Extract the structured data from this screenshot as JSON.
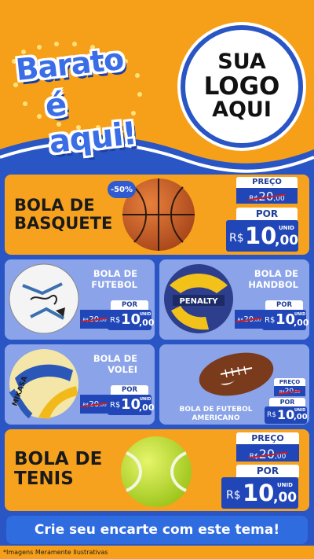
{
  "header": {
    "brand_line1": "Barato",
    "brand_line2": "é aqui!",
    "logo_line1": "SUA",
    "logo_line2": "LOGO",
    "logo_line3": "AQUI"
  },
  "featured_top": {
    "title_line1": "BOLA DE",
    "title_line2": "BASQUETE",
    "badge": "-50%",
    "price_label": "PREÇO",
    "old_price": "R$20,00",
    "old_cur": "R$",
    "old_int": "20",
    "old_dec": ",00",
    "por_label": "POR",
    "currency": "R$",
    "price_int": "10",
    "price_dec": ",00",
    "unit": "UNID"
  },
  "grid": [
    {
      "title_line1": "BOLA DE",
      "title_line2": "FUTEBOL",
      "por_label": "POR",
      "old_cur": "R$",
      "old_int": "20",
      "old_dec": ",00",
      "currency": "R$",
      "price_int": "10",
      "price_dec": ",00",
      "unit": "UNID"
    },
    {
      "title_line1": "BOLA DE",
      "title_line2": "HANDBOL",
      "por_label": "POR",
      "old_cur": "R$",
      "old_int": "20",
      "old_dec": ",00",
      "currency": "R$",
      "price_int": "10",
      "price_dec": ",00",
      "unit": "UNID"
    },
    {
      "title_line1": "BOLA DE",
      "title_line2": "VOLEI",
      "por_label": "POR",
      "old_cur": "R$",
      "old_int": "20",
      "old_dec": ",00",
      "currency": "R$",
      "price_int": "10",
      "price_dec": ",00",
      "unit": "UNID"
    },
    {
      "title_line1": "BOLA DE FUTEBOL",
      "title_line2": "AMERICANO",
      "price_label": "PREÇO",
      "por_label": "POR",
      "old_cur": "R$",
      "old_int": "20",
      "old_dec": ",00",
      "currency": "R$",
      "price_int": "10",
      "price_dec": ",00",
      "unit": "UNID"
    }
  ],
  "featured_bottom": {
    "title_line1": "BOLA DE",
    "title_line2": "TENIS",
    "price_label": "PREÇO",
    "old_cur": "R$",
    "old_int": "20",
    "old_dec": ",00",
    "por_label": "POR",
    "currency": "R$",
    "price_int": "10",
    "price_dec": ",00",
    "unit": "UNID"
  },
  "ball_brands": {
    "handball": "PENALTY",
    "volleyball": "MIKASA"
  },
  "cta": "Crie seu encarte com este tema!",
  "disclaimer": "*Imagens Meramente Ilustrativas",
  "colors": {
    "orange": "#f6a01a",
    "blue": "#2a55c4",
    "card_blue": "#8ba3e8",
    "tag_blue": "#2046b8"
  }
}
